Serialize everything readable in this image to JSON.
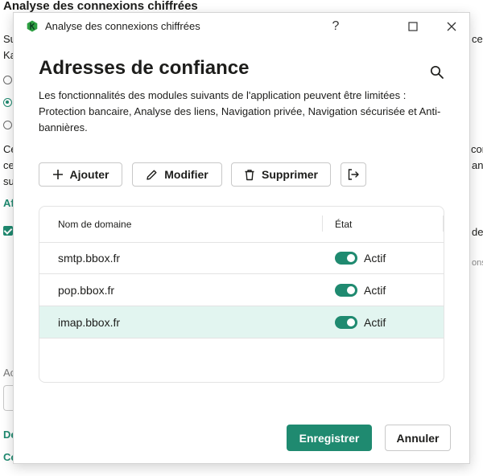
{
  "background": {
    "title": "Analyse des connexions chiffrées",
    "fragments": [
      "Su",
      "Ka",
      "Ce",
      "ce",
      "su",
      "Af",
      "Ac",
      "De",
      "Co",
      "ce",
      "con",
      "an",
      "de",
      "ons"
    ]
  },
  "window": {
    "title": "Analyse des connexions chiffrées",
    "help_glyph": "?"
  },
  "dialog": {
    "heading": "Adresses de confiance",
    "description": "Les fonctionnalités des modules suivants de l'application peuvent être limitées : Protection bancaire, Analyse des liens, Navigation privée, Navigation sécurisée et Anti-bannières."
  },
  "toolbar": {
    "add_label": "Ajouter",
    "edit_label": "Modifier",
    "delete_label": "Supprimer"
  },
  "table": {
    "columns": [
      "Nom de domaine",
      "État"
    ],
    "rows": [
      {
        "domain": "smtp.bbox.fr",
        "state": "Actif",
        "enabled": true,
        "selected": false
      },
      {
        "domain": "pop.bbox.fr",
        "state": "Actif",
        "enabled": true,
        "selected": false
      },
      {
        "domain": "imap.bbox.fr",
        "state": "Actif",
        "enabled": true,
        "selected": true
      }
    ]
  },
  "footer": {
    "save_label": "Enregistrer",
    "cancel_label": "Annuler"
  },
  "colors": {
    "accent": "#1f8a70",
    "selected_row": "#e2f5f0",
    "logo": "#2ea043"
  }
}
